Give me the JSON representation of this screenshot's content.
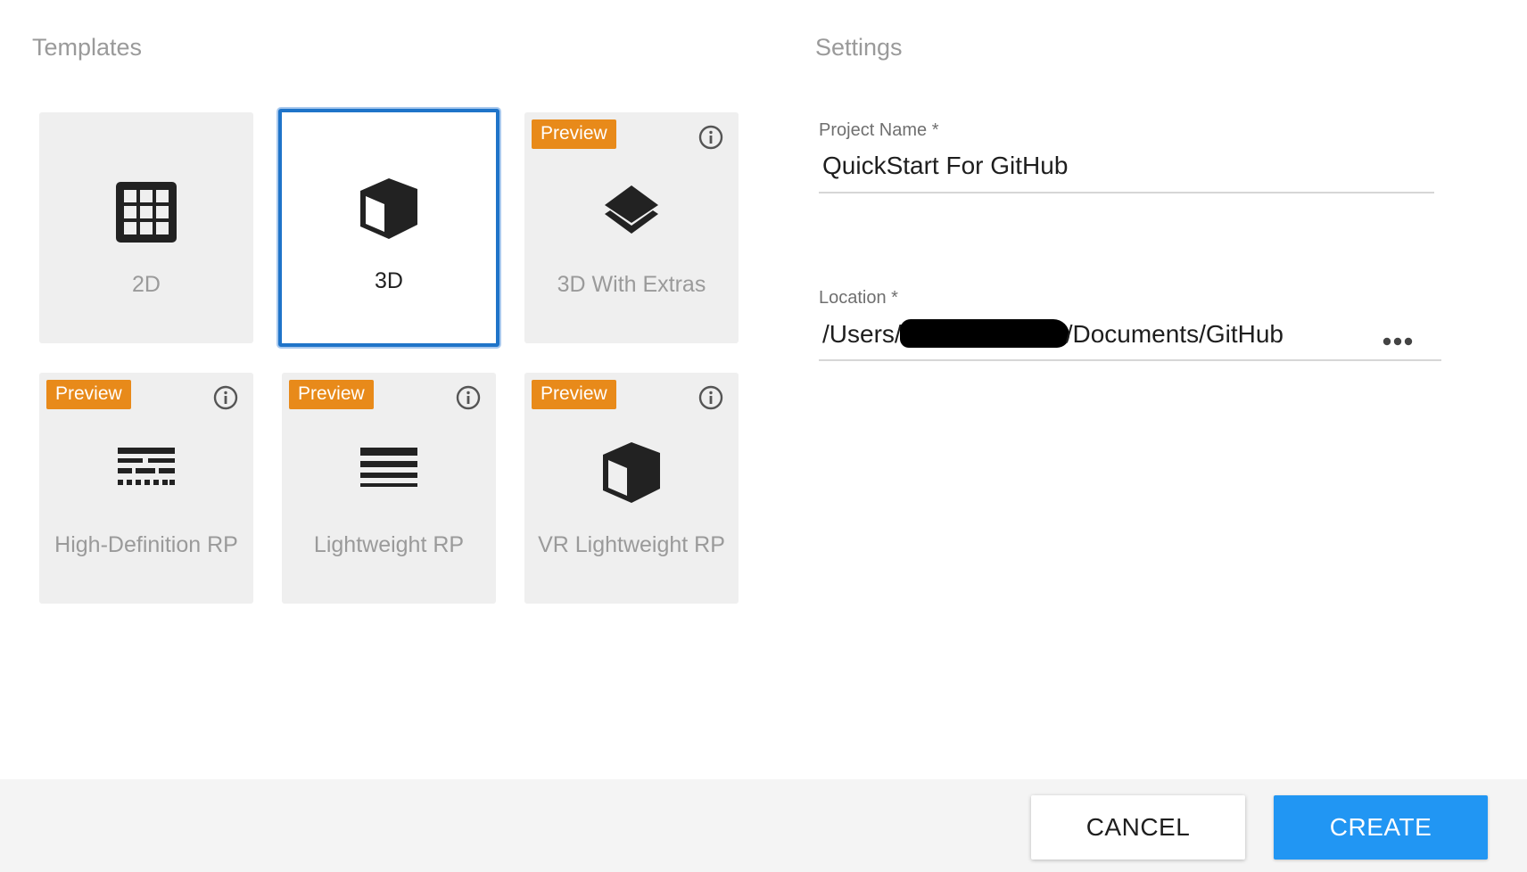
{
  "templates": {
    "title": "Templates",
    "cards": [
      {
        "label": "2D",
        "icon": "grid-icon",
        "preview": false
      },
      {
        "label": "3D",
        "icon": "cube-icon",
        "preview": false,
        "selected": true
      },
      {
        "label": "3D With Extras",
        "icon": "layers-icon",
        "preview": true,
        "badge": "Preview"
      },
      {
        "label": "High-Definition RP",
        "icon": "dashed-lines-icon",
        "preview": true,
        "badge": "Preview"
      },
      {
        "label": "Lightweight RP",
        "icon": "lines-icon",
        "preview": true,
        "badge": "Preview"
      },
      {
        "label": "VR Lightweight RP",
        "icon": "cube-icon",
        "preview": true,
        "badge": "Preview"
      }
    ]
  },
  "settings": {
    "title": "Settings",
    "project_name": {
      "label": "Project Name *",
      "value": "QuickStart For GitHub"
    },
    "location": {
      "label": "Location *",
      "prefix": "/Users/",
      "suffix": "/Documents/GitHub",
      "more_icon": "more-dots-icon"
    }
  },
  "footer": {
    "cancel_label": "CANCEL",
    "create_label": "CREATE"
  },
  "colors": {
    "accent": "#2196f3",
    "selected_border": "#1f74c9",
    "preview_badge": "#e88a1a"
  }
}
